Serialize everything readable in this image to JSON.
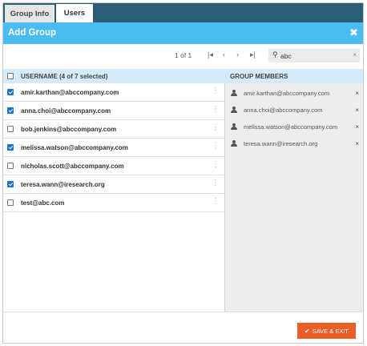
{
  "tabs": [
    {
      "label": "Group Info"
    },
    {
      "label": "Users"
    }
  ],
  "dialog": {
    "title": "Add Group",
    "close_icon": "close-icon"
  },
  "pagination": {
    "info": "1 of 1",
    "first": "|◂",
    "prev": "‹",
    "next": "›",
    "last": "▸|"
  },
  "search": {
    "value": "abc",
    "icon": "search-icon",
    "clear": "×"
  },
  "user_table": {
    "header": "USERNAME (4 of 7 selected)",
    "rows": [
      {
        "email": "amir.karthan@abccompany.com",
        "checked": true
      },
      {
        "email": "anna.choi@abccompany.com",
        "checked": true
      },
      {
        "email": "bob.jenkins@abccompany.com",
        "checked": false
      },
      {
        "email": "melissa.watson@abccompany.com",
        "checked": true
      },
      {
        "email": "nicholas.scott@abccompany.com",
        "checked": false
      },
      {
        "email": "teresa.wann@iresearch.org",
        "checked": true
      },
      {
        "email": "test@abc.com",
        "checked": false
      }
    ]
  },
  "members": {
    "header": "GROUP MEMBERS",
    "items": [
      {
        "email": "amir.karthan@abccompany.com"
      },
      {
        "email": "anna.choi@abccompany.com"
      },
      {
        "email": "melissa.watson@abccompany.com"
      },
      {
        "email": "teresa.wann@iresearch.org"
      }
    ]
  },
  "footer": {
    "save_label": "SAVE & EXIT"
  },
  "colors": {
    "tabbar": "#2c5f77",
    "titlebar": "#4bbcef",
    "header": "#d6ebfa",
    "accent": "#eb5d27",
    "checkbox": "#1a73c9"
  }
}
